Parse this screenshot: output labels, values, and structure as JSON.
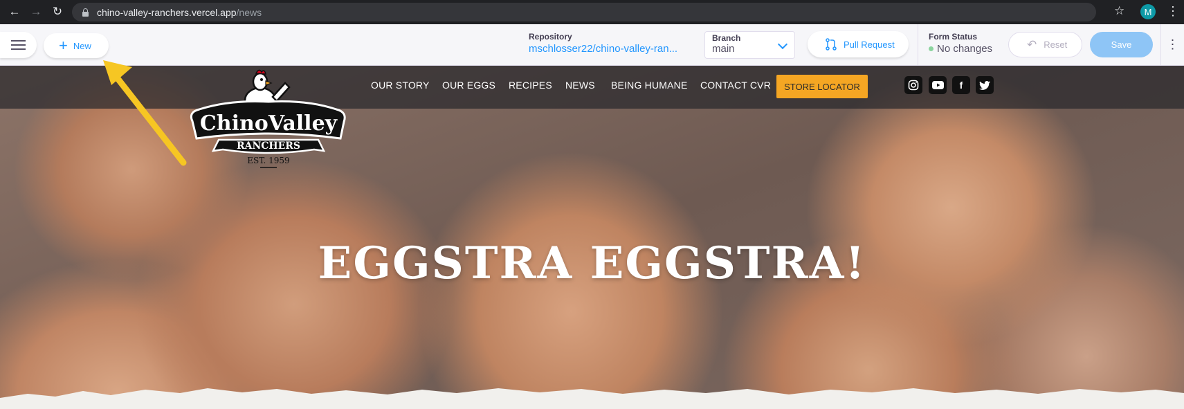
{
  "browser": {
    "url_host": "chino-valley-ranchers.vercel.app",
    "url_path": "/news",
    "profile_initial": "M",
    "icons": [
      "back-icon",
      "forward-icon",
      "reload-icon",
      "lock-icon",
      "star-icon",
      "more-icon"
    ]
  },
  "toolbar": {
    "new_label": "New",
    "repository_label": "Repository",
    "repository_value": "mschlosser22/chino-valley-ran...",
    "branch_label": "Branch",
    "branch_value": "main",
    "pull_request_label": "Pull Request",
    "form_status_label": "Form Status",
    "form_status_value": "No changes",
    "reset_label": "Reset",
    "save_label": "Save"
  },
  "site": {
    "nav": [
      "OUR STORY",
      "OUR EGGS",
      "RECIPES",
      "NEWS",
      "BEING HUMANE",
      "CONTACT CVR"
    ],
    "store_locator": "STORE LOCATOR",
    "social": [
      "instagram-icon",
      "youtube-icon",
      "facebook-icon",
      "twitter-icon"
    ],
    "logo": {
      "line1": "ChinoValley",
      "line2": "RANCHERS",
      "line3": "EST. 1959"
    },
    "headline": "EGGSTRA EGGSTRA!"
  },
  "colors": {
    "accent_blue": "#2296fe",
    "store_orange": "#f5a623",
    "annotation_arrow": "#f6c623"
  }
}
